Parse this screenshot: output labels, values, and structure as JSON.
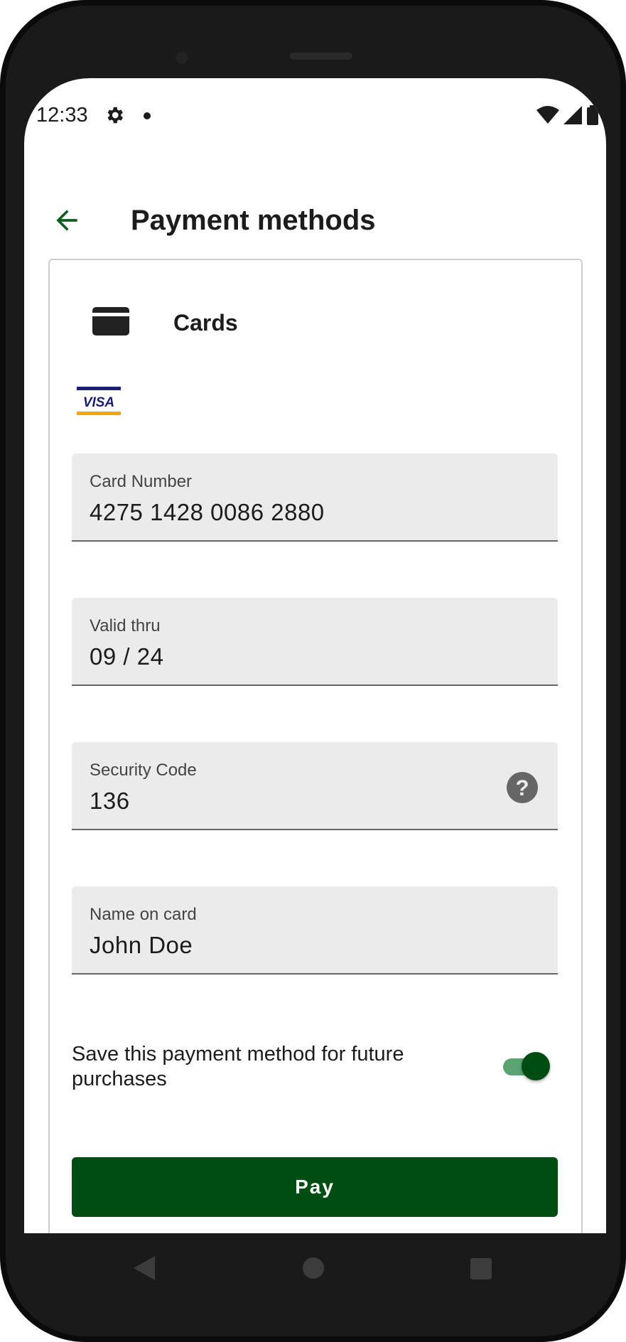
{
  "status_bar": {
    "time": "12:33"
  },
  "app_bar": {
    "title": "Payment methods"
  },
  "payment_card": {
    "section_title": "Cards",
    "brand_logo": "VISA",
    "fields": [
      {
        "label": "Card Number",
        "value": "4275 1428 0086 2880"
      },
      {
        "label": "Valid thru",
        "value": "09 / 24"
      },
      {
        "label": "Security Code",
        "value": "136"
      },
      {
        "label": "Name on card",
        "value": "John Doe"
      }
    ],
    "save_toggle": {
      "label": "Save this payment method for future purchases",
      "checked": true
    },
    "pay_button": "Pay"
  },
  "colors": {
    "accent": "#004d14",
    "toggle_track": "#5aa472",
    "field_background": "#ebebeb"
  },
  "icons": [
    "settings-icon",
    "wifi-icon",
    "signal-icon",
    "battery-icon",
    "back-arrow-icon",
    "credit-card-icon",
    "help-icon",
    "nav-back-icon",
    "nav-home-icon",
    "nav-recents-icon"
  ]
}
